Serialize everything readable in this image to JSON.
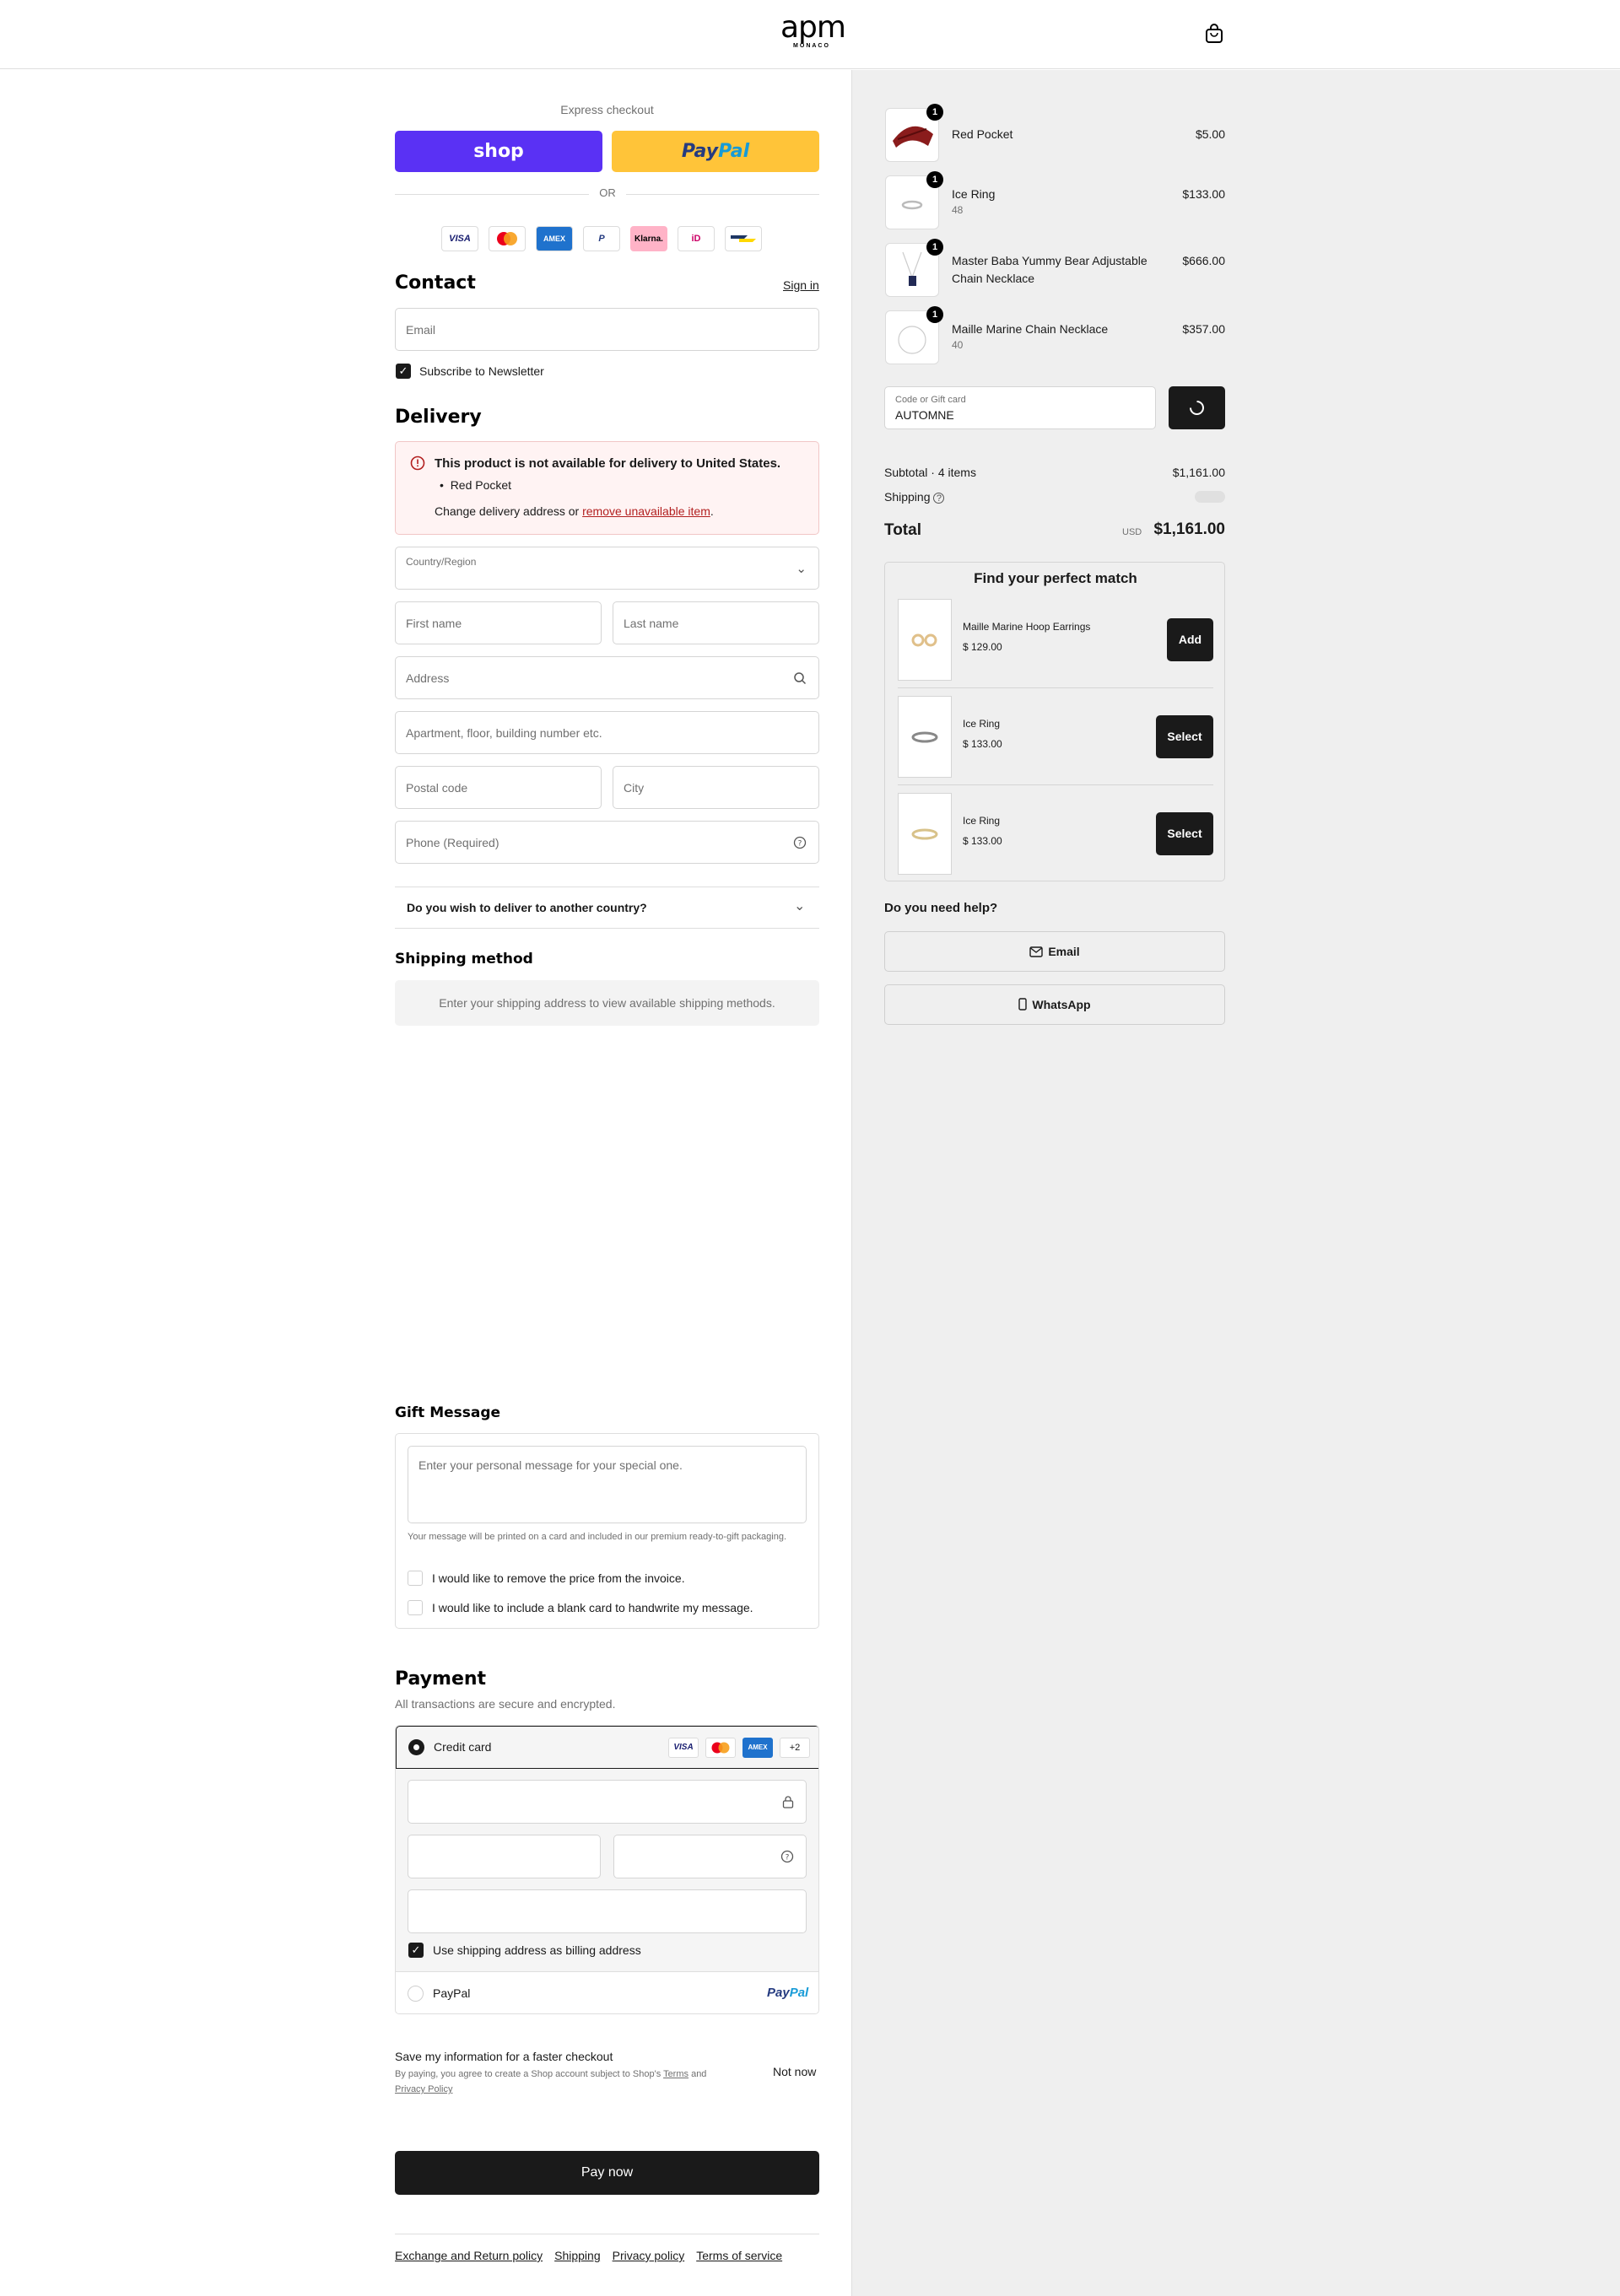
{
  "header": {
    "logo_main": "apm",
    "logo_sub": "MONACO"
  },
  "express": {
    "title": "Express checkout",
    "shop_label": "shop",
    "paypal_a": "Pay",
    "paypal_b": "Pal",
    "or": "OR"
  },
  "payment_icons": [
    "VISA",
    "MC",
    "AMEX",
    "P",
    "Klarna.",
    "iD",
    "BC"
  ],
  "contact": {
    "title": "Contact",
    "sign_in": "Sign in",
    "email_placeholder": "Email",
    "newsletter": "Subscribe to Newsletter"
  },
  "delivery": {
    "title": "Delivery",
    "alert_title": "This product is not available for delivery to United States.",
    "alert_item": "Red Pocket",
    "alert_text": "Change delivery address or ",
    "alert_link": "remove unavailable item",
    "alert_end": ".",
    "country_label": "Country/Region",
    "first_name": "First name",
    "last_name": "Last name",
    "address": "Address",
    "apartment": "Apartment, floor, building number etc.",
    "postal": "Postal code",
    "city": "City",
    "phone": "Phone (Required)",
    "another_country": "Do you wish to deliver to another country?"
  },
  "shipping": {
    "title": "Shipping method",
    "placeholder": "Enter your shipping address to view available shipping methods."
  },
  "gift": {
    "title": "Gift Message",
    "placeholder": "Enter your personal message for your special one.",
    "note": "Your message will be printed on a card and included in our premium ready-to-gift packaging.",
    "opt1": "I would like to remove the price from the invoice.",
    "opt2": "I would like to include a blank card to handwrite my message."
  },
  "payment": {
    "title": "Payment",
    "subtitle": "All transactions are secure and encrypted.",
    "credit_card": "Credit card",
    "card_icons": [
      "VISA",
      "MC",
      "AMEX"
    ],
    "more": "+2",
    "billing_same": "Use shipping address as billing address",
    "paypal": "PayPal",
    "paypal_logo_a": "Pay",
    "paypal_logo_b": "Pal"
  },
  "save_info": {
    "title": "Save my information for a faster checkout",
    "legal_a": "By paying, you agree to create a Shop account subject to Shop's ",
    "terms": "Terms",
    "and": " and",
    "privacy": "Privacy Policy",
    "not_now": "Not now"
  },
  "pay_now": "Pay now",
  "footer": [
    "Exchange and Return policy",
    "Shipping",
    "Privacy policy",
    "Terms of service"
  ],
  "cart": {
    "items": [
      {
        "name": "Red Pocket",
        "variant": "",
        "qty": "1",
        "price": "$5.00"
      },
      {
        "name": "Ice Ring",
        "variant": "48",
        "qty": "1",
        "price": "$133.00"
      },
      {
        "name": "Master Baba Yummy Bear Adjustable",
        "name2": "Chain Necklace",
        "variant": "",
        "qty": "1",
        "price": "$666.00"
      },
      {
        "name": "Maille Marine Chain Necklace",
        "variant": "40",
        "qty": "1",
        "price": "$357.00"
      }
    ],
    "code_label": "Code or Gift card",
    "code_value": "AUTOMNE",
    "subtotal_label": "Subtotal · 4 items",
    "subtotal": "$1,161.00",
    "shipping_label": "Shipping",
    "total_label": "Total",
    "currency": "USD",
    "total": "$1,161.00"
  },
  "match": {
    "title": "Find your perfect match",
    "items": [
      {
        "name": "Maille Marine Hoop Earrings",
        "price": "$ 129.00",
        "btn": "Add"
      },
      {
        "name": "Ice Ring",
        "price": "$ 133.00",
        "btn": "Select"
      },
      {
        "name": "Ice Ring",
        "price": "$ 133.00",
        "btn": "Select"
      }
    ]
  },
  "help": {
    "title": "Do you need help?",
    "email": "Email",
    "whatsapp": "WhatsApp"
  },
  "colors": {
    "shop": "#5a31f4",
    "paypal": "#ffc439",
    "dark": "#1a1a1a",
    "alert_bg": "#fff3f3",
    "panel_bg": "#efefef"
  }
}
